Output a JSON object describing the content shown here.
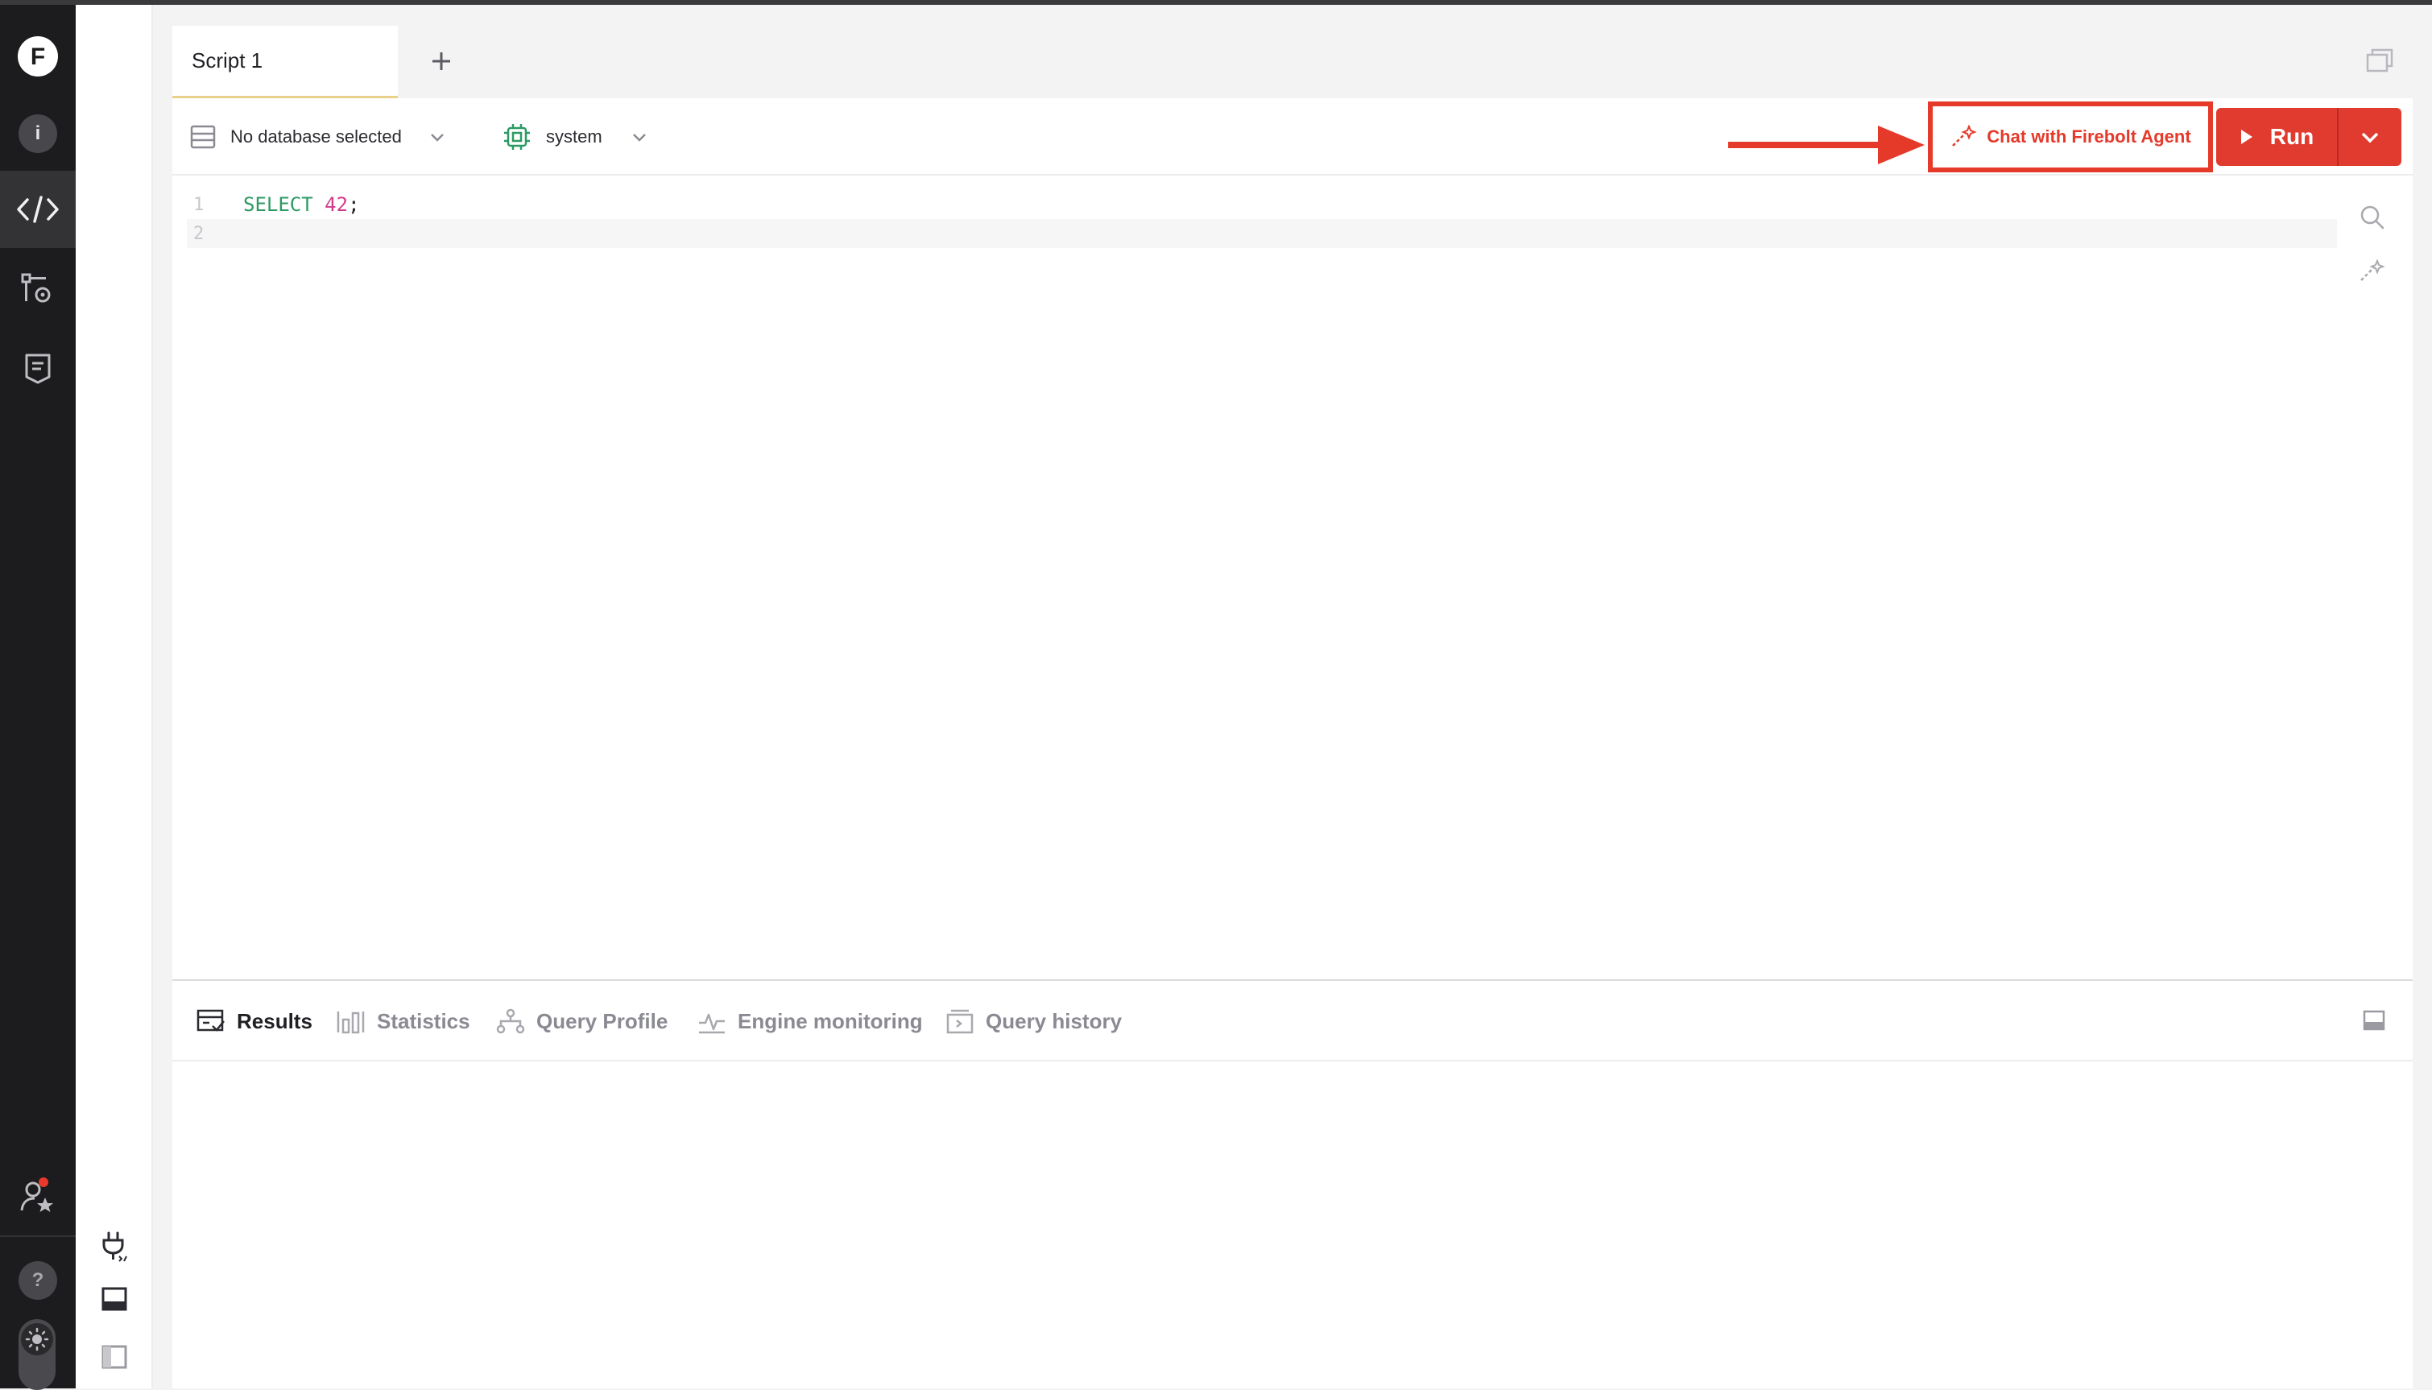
{
  "app": {
    "logo_letter": "F",
    "info_letter": "i",
    "help_symbol": "?"
  },
  "tabs": [
    {
      "label": "Script 1"
    }
  ],
  "toolbar": {
    "database_label": "No database selected",
    "engine_label": "system",
    "agent_button_label": "Chat with Firebolt Agent",
    "run_label": "Run"
  },
  "editor": {
    "lines": [
      {
        "number": "1",
        "keyword": "SELECT",
        "value": "42",
        "end": ";"
      },
      {
        "number": "2"
      }
    ]
  },
  "results_tabs": [
    {
      "label": "Results",
      "icon": "results-icon"
    },
    {
      "label": "Statistics",
      "icon": "statistics-icon"
    },
    {
      "label": "Query Profile",
      "icon": "query-profile-icon"
    },
    {
      "label": "Engine monitoring",
      "icon": "engine-monitoring-icon"
    },
    {
      "label": "Query history",
      "icon": "query-history-icon"
    }
  ],
  "colors": {
    "accent": "#e13b2f",
    "annotation": "#e5392a",
    "keyword": "#2c9a63",
    "number": "#d23a8c",
    "rail": "#1c1c1e"
  }
}
